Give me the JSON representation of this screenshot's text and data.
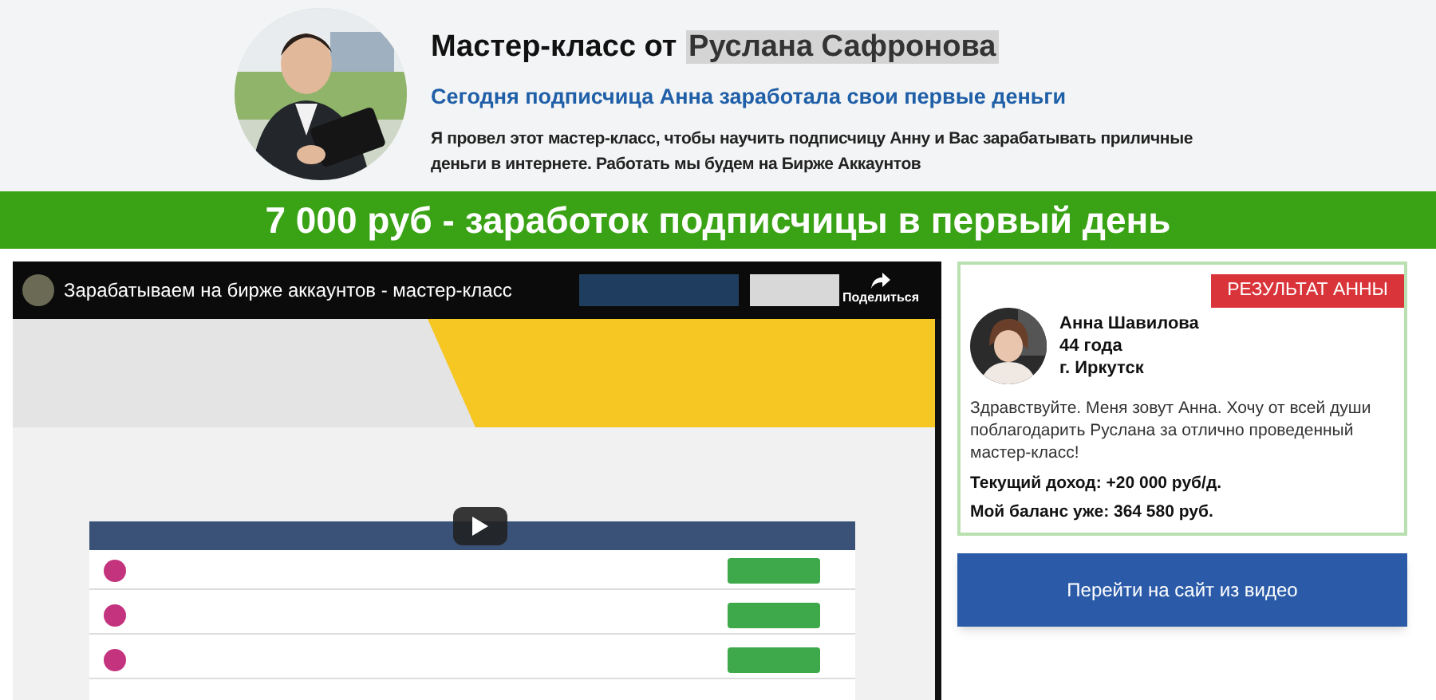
{
  "header": {
    "title": "Мастер-класс от",
    "title_highlight": "Руслана Сафронова",
    "subtitle": "Сегодня подписчица Анна заработала свои первые деньги",
    "description": "Я провел этот мастер-класс, чтобы научить подписчицу Анну и Вас зарабатывать приличные деньги в интернете. Работать мы будем на Бирже Аккаунтов"
  },
  "banner": {
    "text": "7 000 руб - заработок подписчицы в первый день"
  },
  "video": {
    "title": "Зарабатываем на бирже аккаунтов - мастер-класс",
    "share_label": "Поделиться"
  },
  "result_card": {
    "badge": "РЕЗУЛЬТАТ АННЫ",
    "name": "Анна Шавилова",
    "age": "44 года",
    "city": "г. Иркутск",
    "message": "Здравствуйте. Меня зовут Анна. Хочу от всей души поблагодарить Руслана за отлично проведенный  мастер-класс!",
    "income": "Текущий доход: +20 000 руб/д.",
    "balance": "Мой баланс уже: 364 580 руб."
  },
  "cta_button": {
    "label": "Перейти на сайт из видео"
  }
}
